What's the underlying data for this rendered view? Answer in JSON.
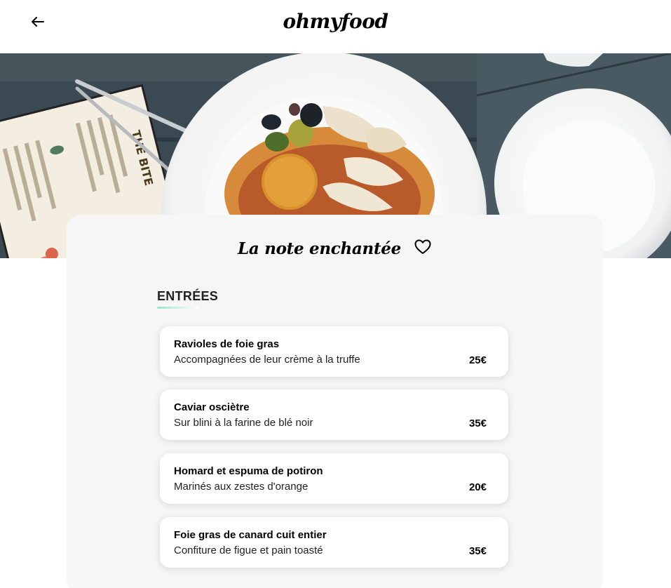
{
  "header": {
    "logo": "ohmyfood",
    "back_icon": "arrow-left-icon"
  },
  "hero": {
    "image": "photo of a plate of grilled squid, olives and arancini on a dark wooden table with a menu and fork"
  },
  "restaurant": {
    "name": "La note enchantée",
    "like_icon": "heart-outline-icon"
  },
  "menu": {
    "section_title": "ENTRÉES",
    "accent_color": "#99e2d0",
    "dishes": [
      {
        "name": "Ravioles de foie gras",
        "description": "Accompagnées de leur crème à la truffe",
        "price": "25€"
      },
      {
        "name": "Caviar oscièt​re",
        "description": "Sur blini à la farine de blé noir",
        "price": "35€"
      },
      {
        "name": "Homard et espuma de potiron",
        "description": "Marinés aux zestes d'orange",
        "price": "20€"
      },
      {
        "name": "Foie gras de canard cuit entier",
        "description": "Confiture de figue et pain toasté",
        "price": "35€"
      }
    ]
  }
}
